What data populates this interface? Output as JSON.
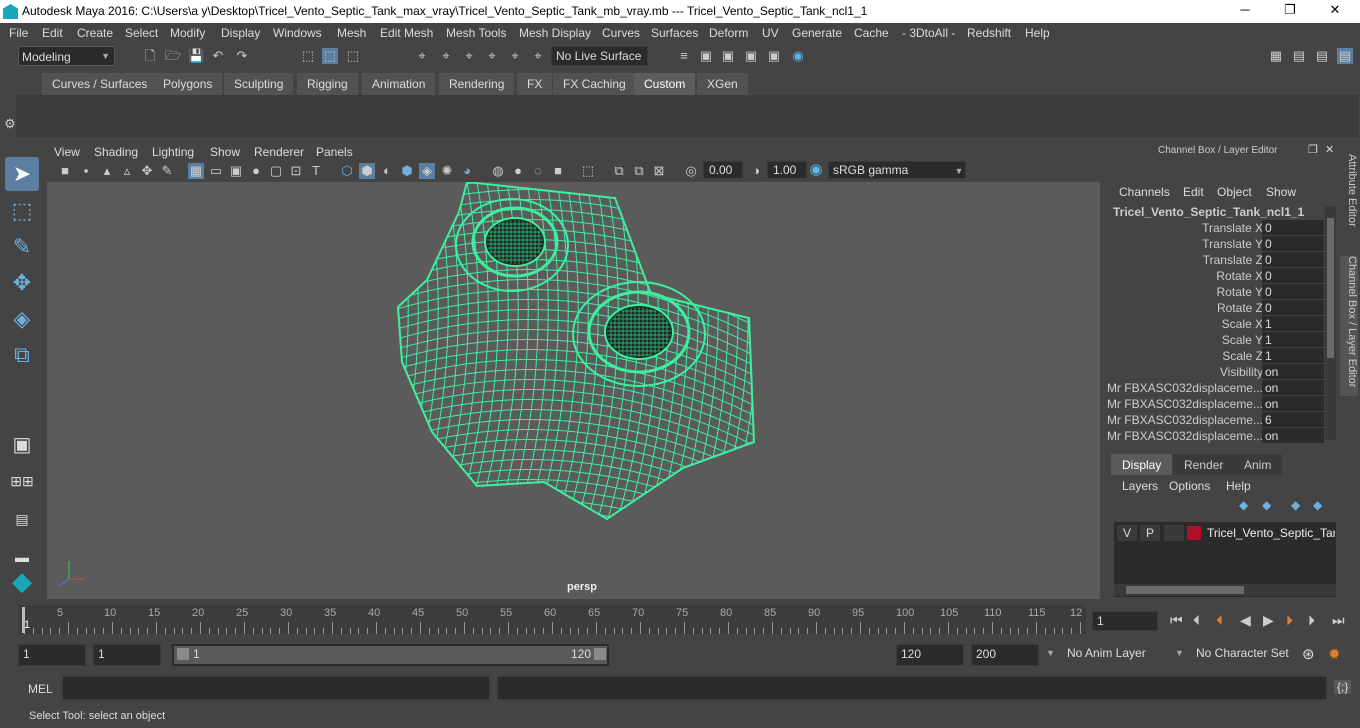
{
  "window": {
    "title": "Autodesk Maya 2016: C:\\Users\\a y\\Desktop\\Tricel_Vento_Septic_Tank_max_vray\\Tricel_Vento_Septic_Tank_mb_vray.mb   ---   Tricel_Vento_Septic_Tank_ncl1_1",
    "minimize": "─",
    "maximize": "❐",
    "close": "✕"
  },
  "menubar": [
    "File",
    "Edit",
    "Create",
    "Select",
    "Modify",
    "Display",
    "Windows",
    "Mesh",
    "Edit Mesh",
    "Mesh Tools",
    "Mesh Display",
    "Curves",
    "Surfaces",
    "Deform",
    "UV",
    "Generate",
    "Cache",
    "- 3DtoAll -",
    "Redshift",
    "Help"
  ],
  "statusline": {
    "mode": "Modeling",
    "live_surface": "No Live Surface"
  },
  "shelf_tabs": [
    "Curves / Surfaces",
    "Polygons",
    "Sculpting",
    "Rigging",
    "Animation",
    "Rendering",
    "FX",
    "FX Caching",
    "Custom",
    "XGen"
  ],
  "shelf_active": "Custom",
  "viewport": {
    "menu": [
      "View",
      "Shading",
      "Lighting",
      "Show",
      "Renderer",
      "Panels"
    ],
    "exposure": "0.00",
    "gamma": "1.00",
    "color_space": "sRGB gamma",
    "camera_label": "persp"
  },
  "channel_box": {
    "header": "Channel Box / Layer Editor",
    "menu": [
      "Channels",
      "Edit",
      "Object",
      "Show"
    ],
    "object_name": "Tricel_Vento_Septic_Tank_ncl1_1",
    "channels": [
      {
        "label": "Translate X",
        "value": "0"
      },
      {
        "label": "Translate Y",
        "value": "0"
      },
      {
        "label": "Translate Z",
        "value": "0"
      },
      {
        "label": "Rotate X",
        "value": "0"
      },
      {
        "label": "Rotate Y",
        "value": "0"
      },
      {
        "label": "Rotate Z",
        "value": "0"
      },
      {
        "label": "Scale X",
        "value": "1"
      },
      {
        "label": "Scale Y",
        "value": "1"
      },
      {
        "label": "Scale Z",
        "value": "1"
      },
      {
        "label": "Visibility",
        "value": "on"
      },
      {
        "label": "Mr FBXASC032displaceme...",
        "value": "on"
      },
      {
        "label": "Mr FBXASC032displaceme...",
        "value": "on"
      },
      {
        "label": "Mr FBXASC032displaceme...",
        "value": "6"
      },
      {
        "label": "Mr FBXASC032displaceme...",
        "value": "on"
      }
    ]
  },
  "layer_editor": {
    "tabs": [
      "Display",
      "Render",
      "Anim"
    ],
    "active_tab": "Display",
    "menu": [
      "Layers",
      "Options",
      "Help"
    ],
    "layer": {
      "v": "V",
      "p": "P",
      "name": "Tricel_Vento_Septic_Tank",
      "color": "#b0102a"
    }
  },
  "side_tabs": [
    "Attribute Editor",
    "Channel Box / Layer Editor"
  ],
  "timeline": {
    "ticks": [
      "5",
      "10",
      "15",
      "20",
      "25",
      "30",
      "35",
      "40",
      "45",
      "50",
      "55",
      "60",
      "65",
      "70",
      "75",
      "80",
      "85",
      "90",
      "95",
      "100",
      "105",
      "110",
      "115",
      "12"
    ],
    "start_marker": "1",
    "current_frame": "1"
  },
  "range": {
    "start": "1",
    "playback_start": "1",
    "slider_start": "1",
    "slider_end": "120",
    "playback_end": "120",
    "end": "200",
    "anim_layer": "No Anim Layer",
    "character_set": "No Character Set"
  },
  "command": {
    "label": "MEL"
  },
  "help_line": "Select Tool: select an object",
  "colors": {
    "wireframe": "#3df0a0",
    "accent": "#5db8e8"
  }
}
